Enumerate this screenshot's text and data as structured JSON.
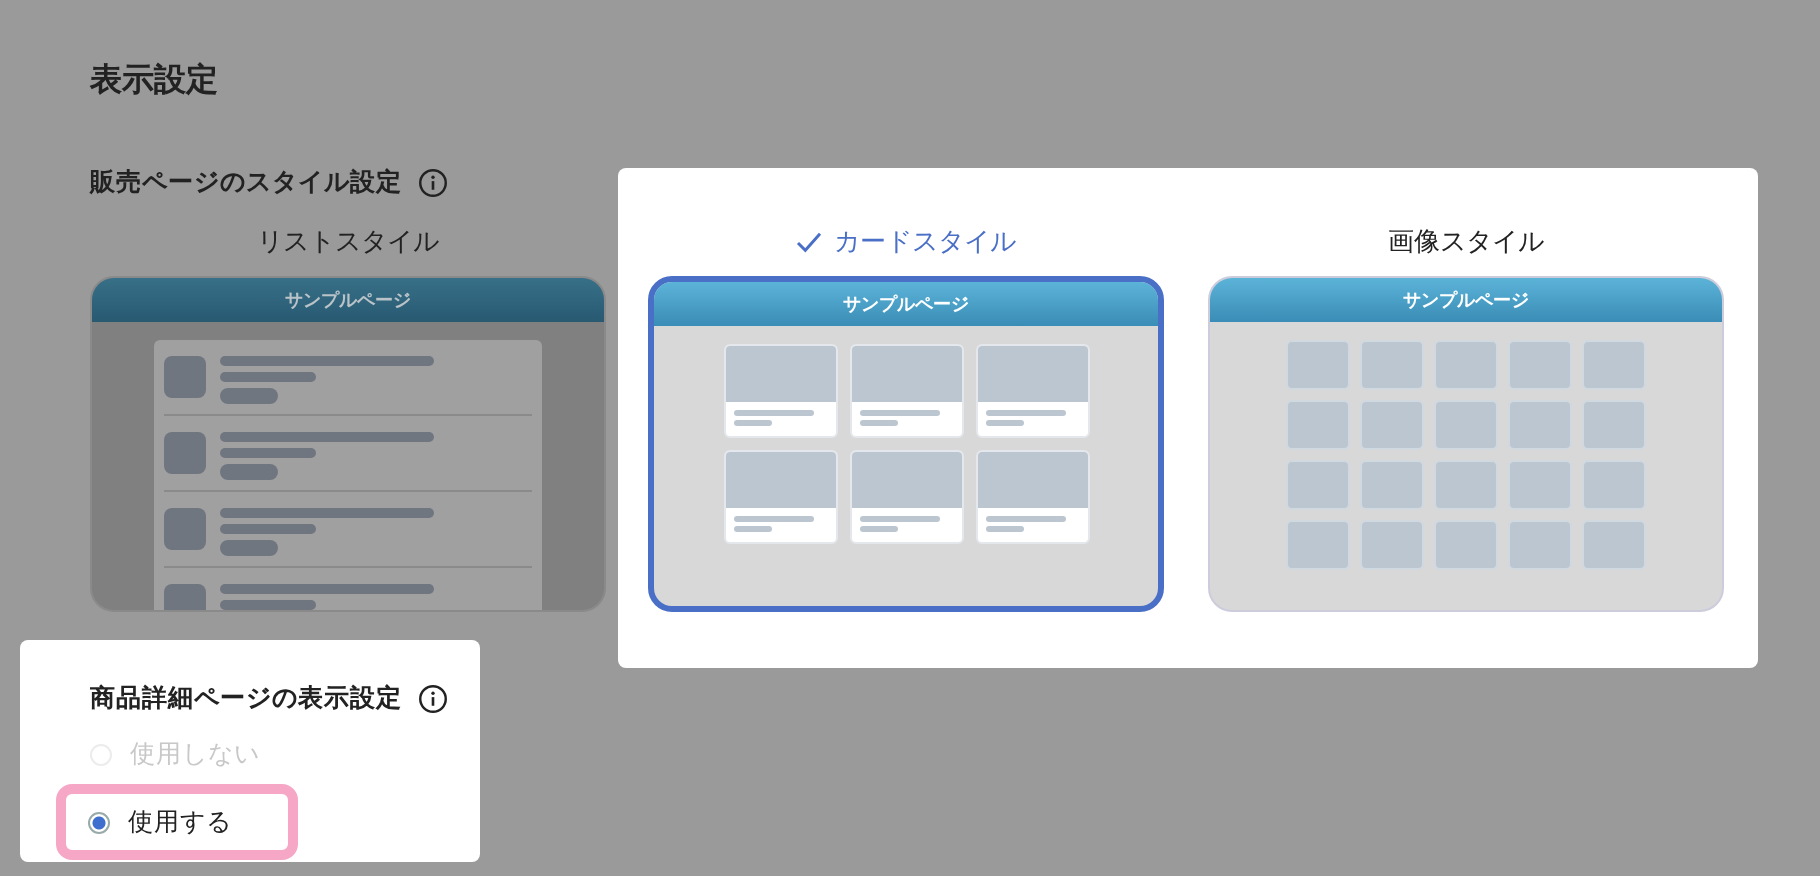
{
  "page_title": "表示設定",
  "style_section": {
    "heading": "販売ページのスタイル設定",
    "options": [
      {
        "label": "リストスタイル",
        "kind": "list",
        "selected": false,
        "preview_title": "サンプルページ"
      },
      {
        "label": "カードスタイル",
        "kind": "card",
        "selected": true,
        "preview_title": "サンプルページ"
      },
      {
        "label": "画像スタイル",
        "kind": "image",
        "selected": false,
        "preview_title": "サンプルページ"
      }
    ]
  },
  "detail_section": {
    "heading": "商品詳細ページの表示設定",
    "options": [
      {
        "label": "使用しない",
        "selected": false,
        "disabled": true
      },
      {
        "label": "使用する",
        "selected": true,
        "disabled": false
      }
    ]
  }
}
